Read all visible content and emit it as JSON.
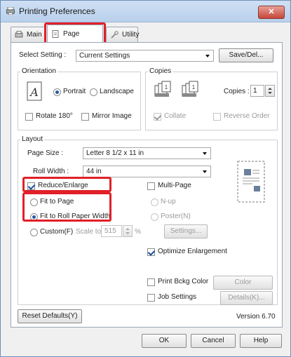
{
  "window": {
    "title": "Printing Preferences",
    "close_label": "✕"
  },
  "tabs": [
    {
      "label": "Main"
    },
    {
      "label": "Page Layout"
    },
    {
      "label": "Utility"
    }
  ],
  "select_setting": {
    "label": "Select Setting :",
    "value": "Current Settings",
    "save_label": "Save/Del..."
  },
  "orientation": {
    "title": "Orientation",
    "portrait": "Portrait",
    "landscape": "Landscape",
    "rotate": "Rotate 180°",
    "mirror": "Mirror Image"
  },
  "copies": {
    "title": "Copies",
    "label": "Copies :",
    "value": "1",
    "collate": "Collate",
    "reverse": "Reverse Order"
  },
  "layout": {
    "title": "Layout",
    "page_size_label": "Page Size :",
    "page_size_value": "Letter 8 1/2 x 11 in",
    "roll_width_label": "Roll Width :",
    "roll_width_value": "44 in",
    "reduce_enlarge": "Reduce/Enlarge",
    "fit_to_page": "Fit to Page",
    "fit_to_roll": "Fit to Roll Paper Width",
    "custom": "Custom(F)",
    "scale_to": "Scale to",
    "scale_value": "515",
    "percent": "%",
    "multi_page": "Multi-Page",
    "n_up": "N-up",
    "poster": "Poster(N)",
    "settings_btn": "Settings...",
    "optimize": "Optimize Enlargement",
    "print_bckg": "Print Bckg Color",
    "color_settings": "Color Settings(H)...",
    "job_settings": "Job Settings",
    "details": "Details(K)..."
  },
  "footer": {
    "reset": "Reset Defaults(Y)",
    "version": "Version 6.70",
    "ok": "OK",
    "cancel": "Cancel",
    "help": "Help"
  },
  "colors": {
    "highlight": "#e0202a",
    "accent": "#2a5aa8"
  }
}
